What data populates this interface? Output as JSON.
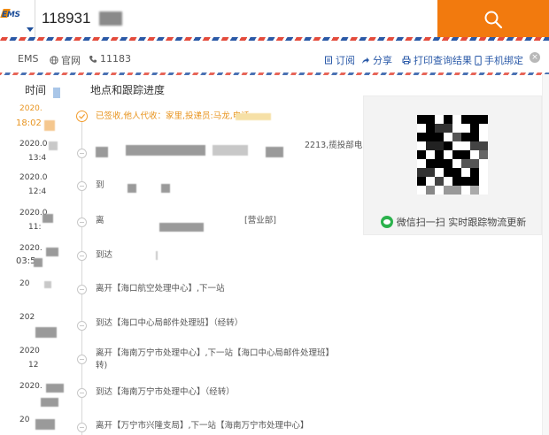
{
  "search": {
    "logo_text": "EMS",
    "query": "118931",
    "icon": "search-icon",
    "button_color": "#f27a0e"
  },
  "toolbar": {
    "brand": "EMS",
    "official_site": "官网",
    "phone": "11183",
    "subscribe": "订阅",
    "share": "分享",
    "print": "打印查询结果",
    "mobile_bind": "手机绑定",
    "close_symbol": "×"
  },
  "table": {
    "time_header": "时间",
    "location_header": "地点和跟踪进度"
  },
  "events": [
    {
      "date": "2020.",
      "time": "18:02",
      "location": "已签收,他人代收：家里,投递员:马龙,电话:",
      "active": true
    },
    {
      "date": "2020.0",
      "time": "13:4",
      "location": "",
      "suffix": "2213,揽投部电"
    },
    {
      "date": "2020.0",
      "time": "12:4",
      "location": "到",
      "suffix": ""
    },
    {
      "date": "2020.0",
      "time": "11:",
      "location": "离",
      "suffix": "[营业部]"
    },
    {
      "date": "2020.",
      "time": "03:5",
      "location": "到达",
      "suffix": ""
    },
    {
      "date": "20",
      "time": "",
      "location": "离开【海口航空处理中心】,下一站",
      "suffix": ""
    },
    {
      "date": "202",
      "time": "",
      "location": "到达【海口中心局邮件处理班】（经转）",
      "suffix": ""
    },
    {
      "date": "2020",
      "time": "12",
      "location": "离开【海南万宁市处理中心】,下一站【海口中心局邮件处理班】",
      "line2": "转)"
    },
    {
      "date": "2020.",
      "time": "",
      "location": "到达【海南万宁市处理中心】（经转）",
      "suffix": ""
    },
    {
      "date": "20",
      "time": "",
      "location": "离开【万宁市兴隆支局】,下一站【海南万宁市处理中心】",
      "suffix": ""
    }
  ],
  "qr": {
    "caption": "微信扫一扫 实时跟踪物流更新"
  }
}
